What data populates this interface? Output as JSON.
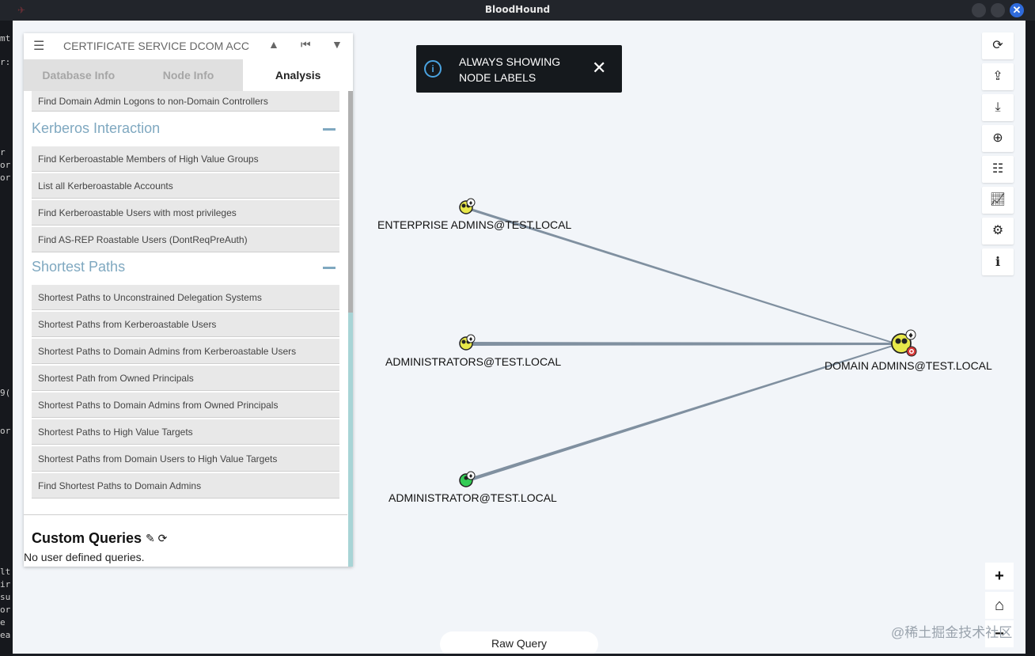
{
  "window": {
    "title": "BloodHound"
  },
  "terminal_fragments": [
    "mt",
    "r:",
    "r",
    "or",
    "or",
    "9(",
    "or",
    "lt",
    "ir",
    "su",
    "or",
    "e",
    "ea"
  ],
  "panel": {
    "search_text": "CERTIFICATE SERVICE DCOM ACC",
    "tabs": [
      {
        "label": "Database Info",
        "active": false
      },
      {
        "label": "Node Info",
        "active": false
      },
      {
        "label": "Analysis",
        "active": true
      }
    ],
    "top_query": "Find Domain Admin Logons to non-Domain Controllers",
    "sections": [
      {
        "title": "Kerberos Interaction",
        "queries": [
          "Find Kerberoastable Members of High Value Groups",
          "List all Kerberoastable Accounts",
          "Find Kerberoastable Users with most privileges",
          "Find AS-REP Roastable Users (DontReqPreAuth)"
        ]
      },
      {
        "title": "Shortest Paths",
        "queries": [
          "Shortest Paths to Unconstrained Delegation Systems",
          "Shortest Paths from Kerberoastable Users",
          "Shortest Paths to Domain Admins from Kerberoastable Users",
          "Shortest Path from Owned Principals",
          "Shortest Paths to Domain Admins from Owned Principals",
          "Shortest Paths to High Value Targets",
          "Shortest Paths from Domain Users to High Value Targets",
          "Find Shortest Paths to Domain Admins"
        ]
      }
    ],
    "custom_queries": {
      "title": "Custom Queries",
      "empty_text": "No user defined queries."
    }
  },
  "toast": {
    "line1": "ALWAYS SHOWING",
    "line2": "NODE LABELS"
  },
  "graph": {
    "nodes": [
      {
        "label": "ENTERPRISE ADMINS@TEST.LOCAL",
        "kind": "group"
      },
      {
        "label": "ADMINISTRATORS@TEST.LOCAL",
        "kind": "group"
      },
      {
        "label": "ADMINISTRATOR@TEST.LOCAL",
        "kind": "user"
      },
      {
        "label": "DOMAIN ADMINS@TEST.LOCAL",
        "kind": "group-target"
      }
    ],
    "colors": {
      "group": "#e8e84a",
      "user": "#33cc55",
      "edge": "#8090a0",
      "target": "#d63a3a"
    }
  },
  "toolbar": {
    "icons": [
      "refresh-icon",
      "upload-icon",
      "download-icon",
      "upload-circle-icon",
      "list-icon",
      "chart-icon",
      "settings-icon",
      "info-icon"
    ],
    "zoom": [
      "zoom-in-icon",
      "home-icon",
      "zoom-out-icon"
    ]
  },
  "raw_query": {
    "label": "Raw Query"
  },
  "watermark": "@稀土掘金技术社区"
}
